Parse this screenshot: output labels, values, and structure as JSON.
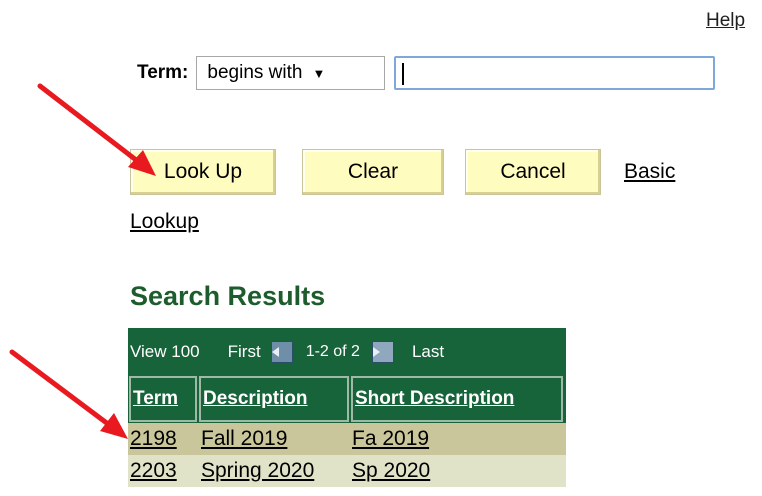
{
  "header": {
    "help_label": "Help"
  },
  "search": {
    "field_label": "Term:",
    "operator_value": "begins with",
    "input_value": ""
  },
  "buttons": {
    "lookup": "Look Up",
    "clear": "Clear",
    "cancel": "Cancel",
    "basic_lookup_line1": "Basic",
    "basic_lookup_line2": "Lookup"
  },
  "results": {
    "heading": "Search Results",
    "nav": {
      "view_all": "View 100",
      "first": "First",
      "count": "1-2 of 2",
      "last": "Last"
    },
    "columns": [
      "Term",
      "Description",
      "Short Description"
    ],
    "rows": [
      {
        "term": "2198",
        "description": "Fall 2019",
        "short": "Fa 2019"
      },
      {
        "term": "2203",
        "description": "Spring 2020",
        "short": "Sp 2020"
      }
    ]
  },
  "colors": {
    "accent_green": "#17633a",
    "button_yellow": "#fffcbf",
    "annotation_arrow": "#e8191f"
  }
}
